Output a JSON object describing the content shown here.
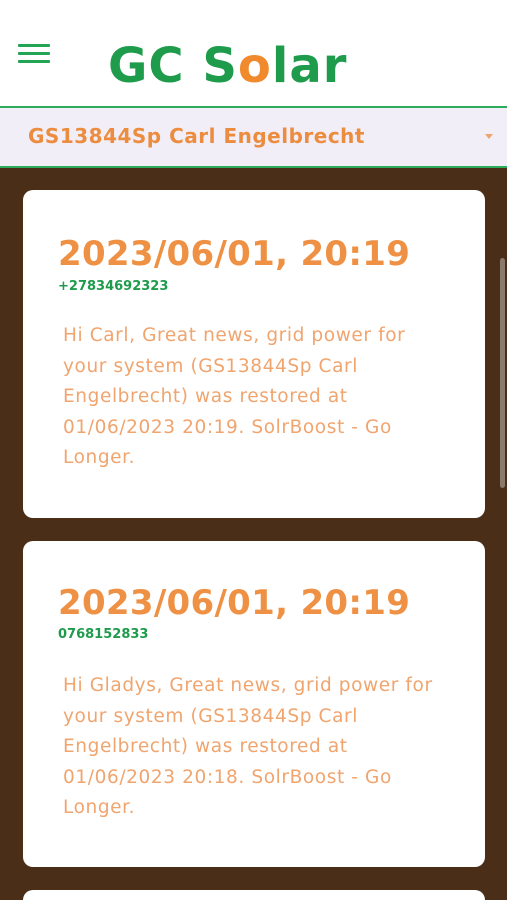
{
  "header": {
    "menu_icon": "hamburger-menu-icon",
    "logo_part1": "GC S",
    "logo_o": "o",
    "logo_part2": "lar"
  },
  "system_select": {
    "selected": "GS13844Sp Carl Engelbrecht",
    "icon": "caret-down-icon"
  },
  "colors": {
    "brand_green": "#1e9b4b",
    "brand_orange": "#f08a2c",
    "content_bg": "#4a2e17"
  },
  "messages": [
    {
      "date": "2023/06/01, 20:19",
      "phone": "+27834692323",
      "text": "Hi Carl, Great news, grid power for your system (GS13844Sp Carl Engelbrecht) was restored at 01/06/2023 20:19. SolrBoost - Go Longer."
    },
    {
      "date": "2023/06/01, 20:19",
      "phone": "0768152833",
      "text": "Hi Gladys, Great news, grid power for your system (GS13844Sp Carl Engelbrecht) was restored at 01/06/2023 20:18. SolrBoost - Go Longer."
    }
  ]
}
